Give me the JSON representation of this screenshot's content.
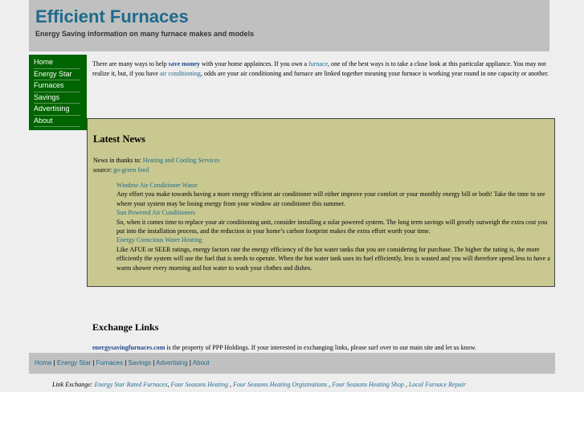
{
  "header": {
    "title": "Efficient Furnaces",
    "tagline": "Energy Saving information on many furnace makes and models"
  },
  "sidebar": {
    "items": [
      {
        "label": "Home"
      },
      {
        "label": "Energy Star"
      },
      {
        "label": "Furnaces"
      },
      {
        "label": "Savings"
      },
      {
        "label": "Advertising"
      },
      {
        "label": "About"
      }
    ]
  },
  "intro": {
    "t1": "There are many ways to help ",
    "link1": "save money",
    "t2": " with your home applainces. If you own a ",
    "link2": "furnace",
    "t3": ", one of the best ways is to take a close look at this particular appliance. You may not realize it, but, if you have ",
    "link3": "air conditioning",
    "t4": ", odds are your air conditioning and furnace are linked together meaning your furnace is working year round in one capacity or another."
  },
  "news": {
    "heading": "Latest News",
    "credit_prefix": "News in thanks to: ",
    "credit_link": "Heating and Cooling Services",
    "source_prefix": "source: ",
    "source_link": "go-green feed",
    "items": [
      {
        "title": "Window Air Conditioner Waste",
        "body": "Any effort you make towards having a more energy efficient air conditioner will either improve your comfort or your monthly energy bill or both! Take the time to see where your system may be losing energy from your window air conditioner this summer."
      },
      {
        "title": "Sun Powered Air Conditioners",
        "body": "So, when it comes time to replace your air conditioning unit, consider installing a solar powered system. The long term savings will greatly outweigh the extra cost you put into the installation process, and the reduction in your home’s carbon footprint makes the extra effort worth your time."
      },
      {
        "title": "Energy Conscious Water Heating",
        "body": "Like AFUE or SEER ratings, energy factors rate the energy efficiency of the hot water tanks that you are considering for purchase. The higher the rating is, the more efficiently the system will use the fuel that is needs to operate. When the hot water tank uses its fuel efficiently, less is wasted and you will therefore spend less to have a warm shower every morning and hot water to wash your clothes and dishes."
      }
    ]
  },
  "exchange": {
    "heading": "Exchange Links",
    "site_link": "energysavingfurnaces.com",
    "text": " is the property of PPP Holdings. If your interested in exchanging links, please surf over to our main site and let us know."
  },
  "footer": {
    "items": [
      "Home",
      "Energy Star",
      "Furnaces",
      "Savings",
      "Advertising",
      "About"
    ],
    "separator": " | "
  },
  "link_exchange": {
    "label": "Link Exchange: ",
    "links": [
      "Energy Star Rated Furnaces",
      "Four Seasons Heating ",
      "Four Seasons Heating Orgizinations ",
      "Four Seasons Heating Shop ",
      "Local Furnace Repair"
    ],
    "separator": ", "
  },
  "colors": {
    "link": "#1e6a8c",
    "nav_bg": "#006400",
    "news_bg": "#c8c890",
    "header_bg": "#c0c0c0"
  }
}
